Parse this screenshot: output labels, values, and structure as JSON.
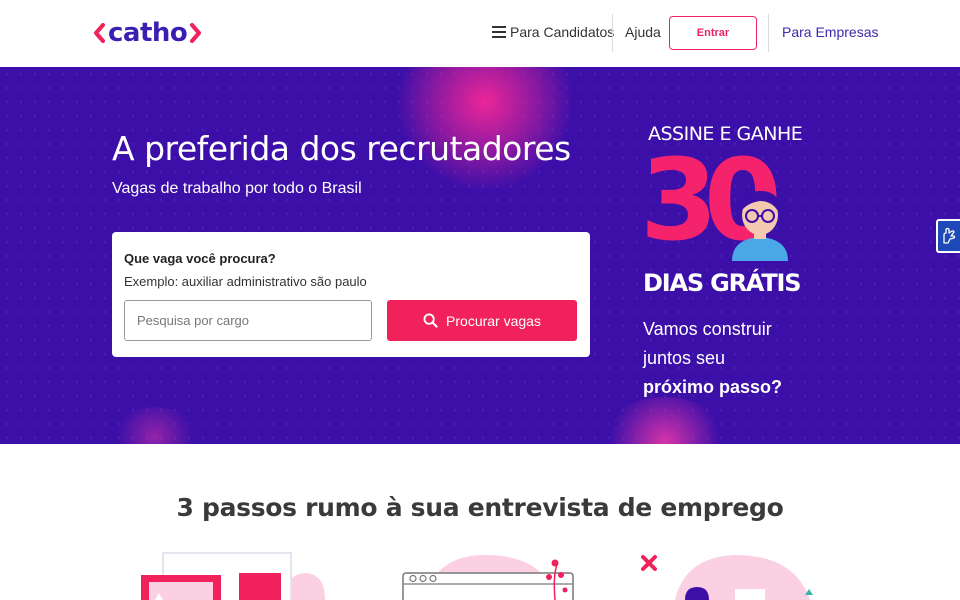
{
  "header": {
    "logo_text": "catho",
    "nav_candidatos": "Para Candidatos",
    "nav_ajuda": "Ajuda",
    "entrar_label": "Entrar",
    "nav_empresas": "Para Empresas"
  },
  "hero": {
    "title": "A preferida dos recrutadores",
    "subtitle": "Vagas de trabalho por todo o Brasil",
    "search": {
      "question": "Que vaga você procura?",
      "example": "Exemplo: auxiliar administrativo são paulo",
      "placeholder": "Pesquisa por cargo",
      "button_label": "Procurar vagas"
    },
    "promo": {
      "headline": "ASSINE E GANHE",
      "number": "30",
      "days": "DIAS GRÁTIS",
      "line1": "Vamos construir",
      "line2": "juntos seu",
      "line3": "próximo passo?"
    }
  },
  "steps": {
    "title": "3 passos rumo à sua entrevista de emprego"
  },
  "colors": {
    "brand_purple": "#3b0fa8",
    "brand_pink": "#f0215b",
    "logo_blue": "#3b1fb3",
    "link_blue": "#3b2bb0"
  },
  "icons": [
    "chevron-left-icon",
    "chevron-right-icon",
    "menu-icon",
    "search-icon",
    "sign-language-icon"
  ]
}
